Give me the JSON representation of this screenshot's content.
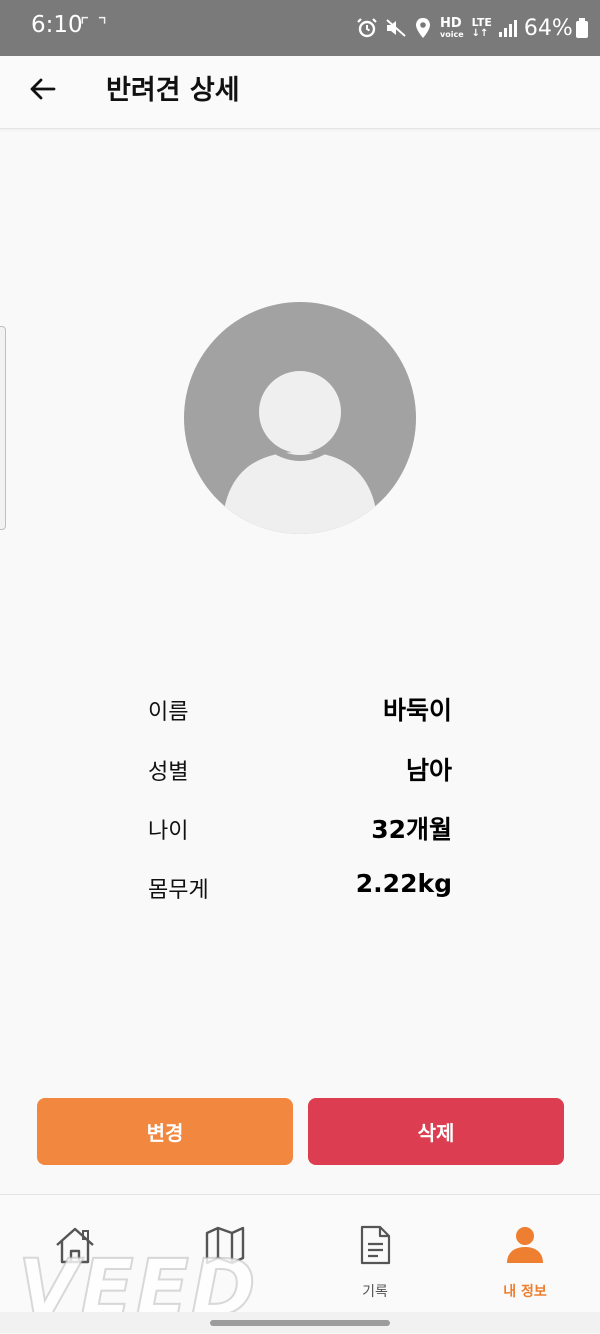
{
  "status_bar": {
    "time": "6:10",
    "battery": "64%",
    "icons": [
      "screenshot-bracket-icon",
      "alarm-icon",
      "mute-icon",
      "location-icon",
      "hd-voice-icon",
      "lte-icon",
      "signal-icon",
      "battery-icon"
    ],
    "hd_label": "HD",
    "voice_label": "voice",
    "lte_label": "LTE"
  },
  "app_bar": {
    "title": "반려견 상세",
    "back_icon": "arrow-left-icon"
  },
  "profile": {
    "avatar_icon": "person-placeholder-icon",
    "fields": [
      {
        "label": "이름",
        "value": "바둑이"
      },
      {
        "label": "성별",
        "value": "남아"
      },
      {
        "label": "나이",
        "value": "32개월"
      },
      {
        "label": "몸무게",
        "value": "2.22kg"
      }
    ]
  },
  "actions": {
    "edit_label": "변경",
    "delete_label": "삭제"
  },
  "bottom_nav": {
    "items": [
      {
        "label": "",
        "icon": "home-icon"
      },
      {
        "label": "",
        "icon": "map-icon"
      },
      {
        "label": "기록",
        "icon": "document-icon"
      },
      {
        "label": "내 정보",
        "icon": "person-icon"
      }
    ],
    "active_index": 3
  },
  "watermark": "VEED",
  "colors": {
    "accent": "#f28740",
    "danger": "#dc3d50",
    "nav_active": "#ee7e30",
    "avatar_bg": "#a2a2a2",
    "avatar_fg": "#efefef"
  }
}
